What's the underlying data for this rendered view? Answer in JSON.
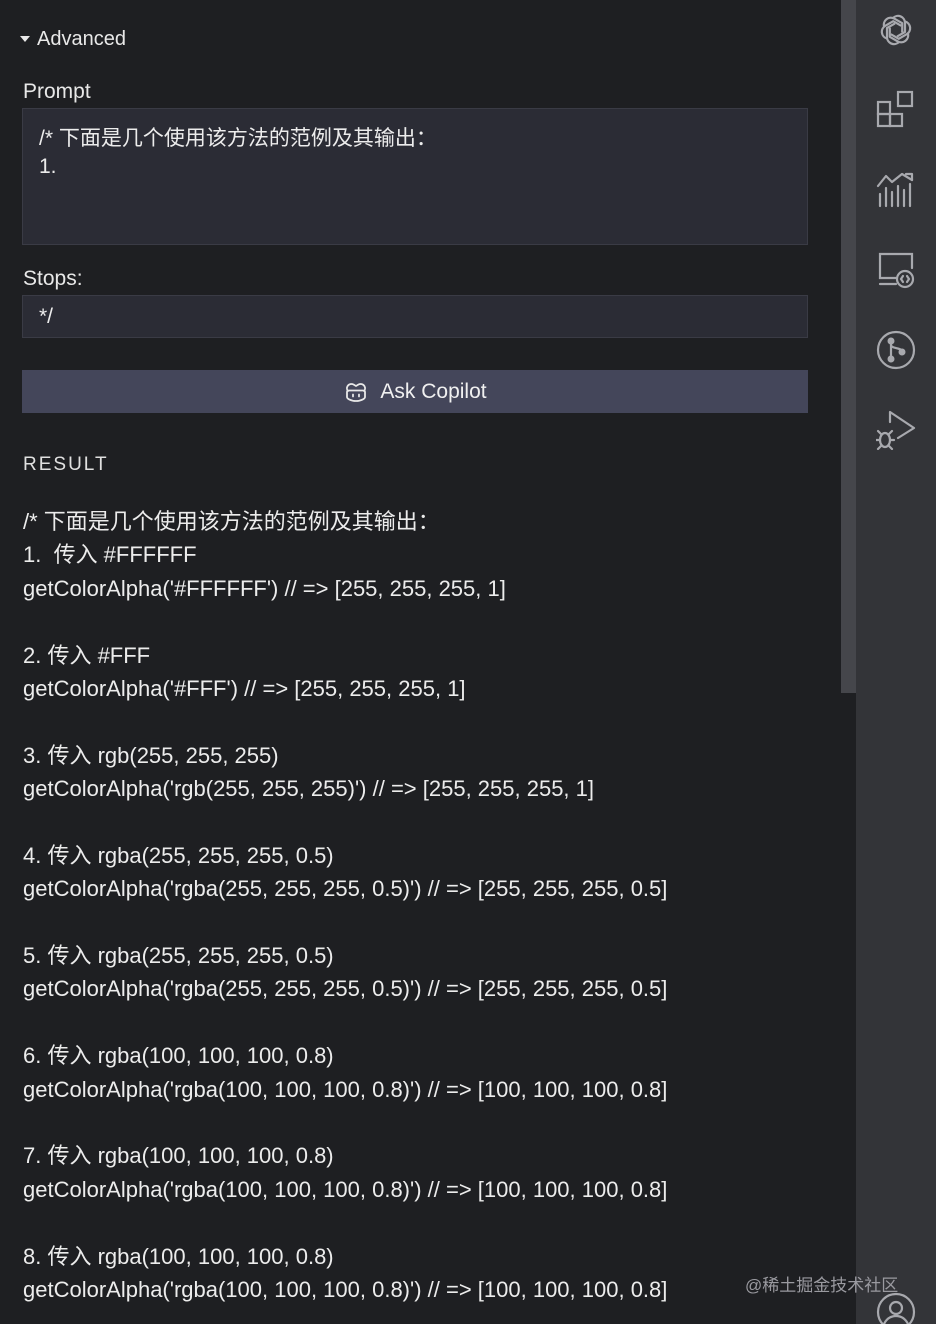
{
  "panel": {
    "advanced_toggle": "Advanced",
    "prompt_label": "Prompt",
    "prompt_value": "/* 下面是几个使用该方法的范例及其输出：\n1.",
    "stops_label": "Stops:",
    "stops_value": "*/",
    "ask_button_label": "Ask Copilot",
    "result_heading": "RESULT",
    "result_lines": [
      "/* 下面是几个使用该方法的范例及其输出：",
      "1.  传入 #FFFFFF",
      "getColorAlpha('#FFFFFF') // => [255, 255, 255, 1]",
      "",
      "2. 传入 #FFF",
      "getColorAlpha('#FFF') // => [255, 255, 255, 1]",
      "",
      "3. 传入 rgb(255, 255, 255)",
      "getColorAlpha('rgb(255, 255, 255)') // => [255, 255, 255, 1]",
      "",
      "4. 传入 rgba(255, 255, 255, 0.5)",
      "getColorAlpha('rgba(255, 255, 255, 0.5)') // => [255, 255, 255, 0.5]",
      "",
      "5. 传入 rgba(255, 255, 255, 0.5)",
      "getColorAlpha('rgba(255, 255, 255, 0.5)') // => [255, 255, 255, 0.5]",
      "",
      "6. 传入 rgba(100, 100, 100, 0.8)",
      "getColorAlpha('rgba(100, 100, 100, 0.8)') // => [100, 100, 100, 0.8]",
      "",
      "7. 传入 rgba(100, 100, 100, 0.8)",
      "getColorAlpha('rgba(100, 100, 100, 0.8)') // => [100, 100, 100, 0.8]",
      "",
      "8. 传入 rgba(100, 100, 100, 0.8)",
      "getColorAlpha('rgba(100, 100, 100, 0.8)') // => [100, 100, 100, 0.8]"
    ]
  },
  "activity_bar": {
    "icons": [
      "openai-icon",
      "extensions-icon",
      "analytics-icon",
      "remote-explorer-icon",
      "source-control-icon",
      "run-debug-icon",
      "account-icon"
    ]
  },
  "watermark": "@稀土掘金技术社区",
  "colors": {
    "background": "#1e1f22",
    "input_background": "#2b2c35",
    "button_background": "#44465a",
    "activity_bar": "#333438",
    "icon": "#a8a9ae"
  }
}
